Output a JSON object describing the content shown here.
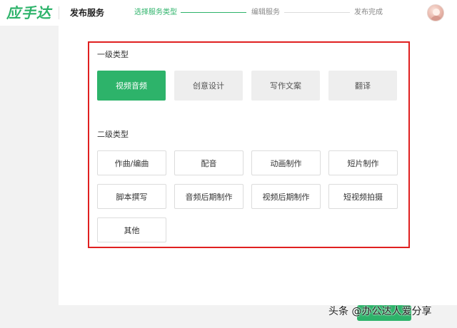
{
  "header": {
    "logo_text": "应手达",
    "page_title": "发布服务",
    "steps": [
      {
        "label": "选择服务类型",
        "state": "active"
      },
      {
        "label": "编辑服务",
        "state": "pending"
      },
      {
        "label": "发布完成",
        "state": "pending"
      }
    ]
  },
  "level1": {
    "label": "一级类型",
    "selected": "视频音频",
    "options": [
      "视频音频",
      "创意设计",
      "写作文案",
      "翻译"
    ]
  },
  "level2": {
    "label": "二级类型",
    "options": [
      "作曲/编曲",
      "配音",
      "动画制作",
      "短片制作",
      "脚本撰写",
      "音频后期制作",
      "视频后期制作",
      "短视频拍摄",
      "其他"
    ]
  },
  "watermark": "头条 @办公达人爱分享",
  "colors": {
    "accent": "#2db36a",
    "highlight_frame": "#e02020",
    "unselected_bg": "#eeeeee"
  }
}
